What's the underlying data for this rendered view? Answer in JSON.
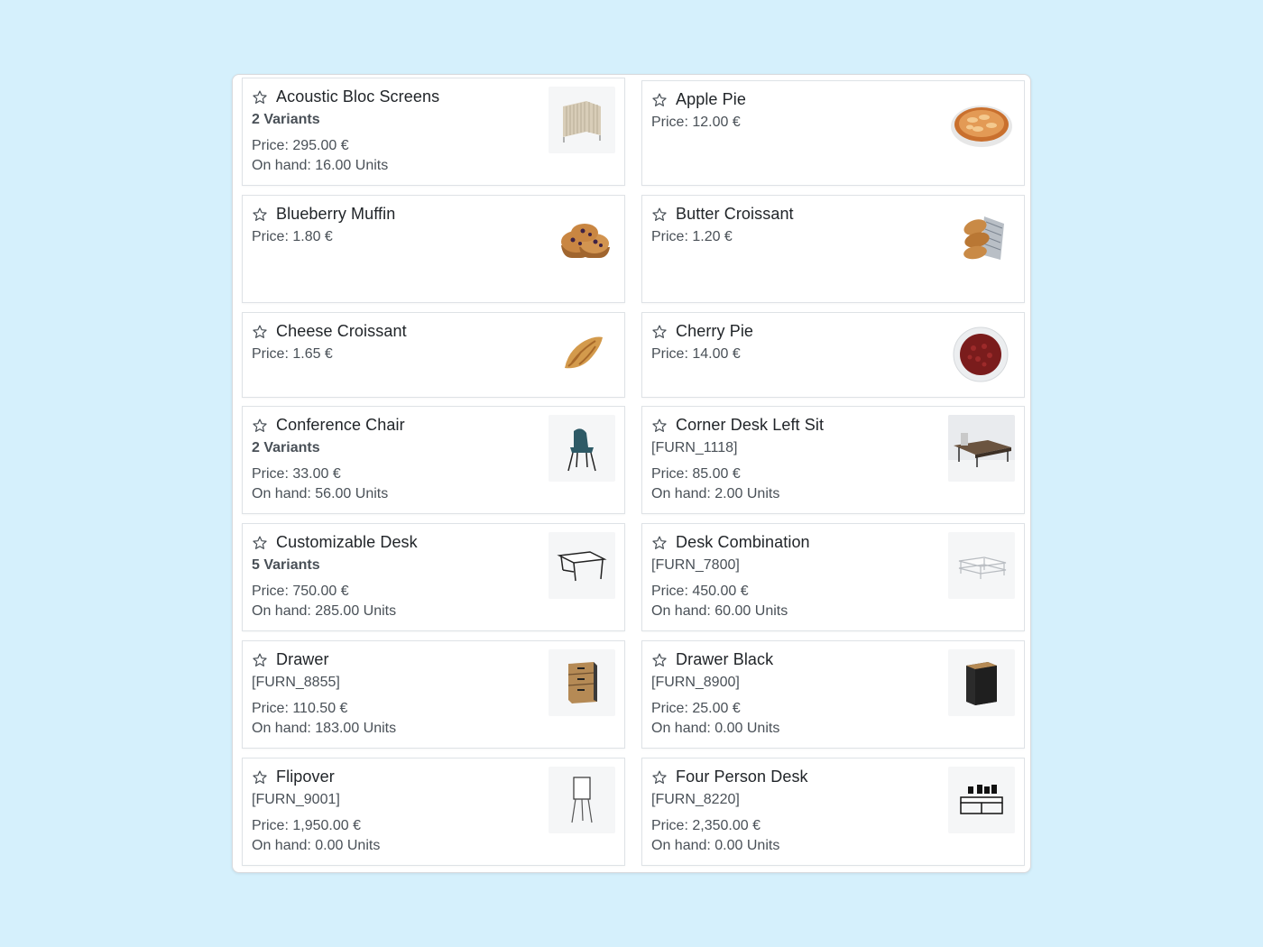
{
  "products": [
    {
      "name": "Acoustic Bloc Screens",
      "variants": "2 Variants",
      "price": "Price: 295.00 €",
      "onhand": "On hand: 16.00 Units",
      "image": "acoustic-screen-image"
    },
    {
      "name": "Apple Pie",
      "price": "Price: 12.00 €",
      "image": "apple-pie-image"
    },
    {
      "name": "Blueberry Muffin",
      "price": "Price: 1.80 €",
      "image": "blueberry-muffin-image"
    },
    {
      "name": "Butter Croissant",
      "price": "Price: 1.20 €",
      "image": "butter-croissant-image"
    },
    {
      "name": "Cheese Croissant",
      "price": "Price: 1.65 €",
      "image": "cheese-croissant-image"
    },
    {
      "name": "Cherry Pie",
      "price": "Price: 14.00 €",
      "image": "cherry-pie-image"
    },
    {
      "name": "Conference Chair",
      "variants": "2 Variants",
      "price": "Price: 33.00 €",
      "onhand": "On hand: 56.00 Units",
      "image": "conference-chair-image"
    },
    {
      "name": "Corner Desk Left Sit",
      "ref": "[FURN_1118]",
      "price": "Price: 85.00 €",
      "onhand": "On hand: 2.00 Units",
      "image": "corner-desk-image"
    },
    {
      "name": "Customizable Desk",
      "variants": "5 Variants",
      "price": "Price: 750.00 €",
      "onhand": "On hand: 285.00 Units",
      "image": "customizable-desk-image"
    },
    {
      "name": "Desk Combination",
      "ref": "[FURN_7800]",
      "price": "Price: 450.00 €",
      "onhand": "On hand: 60.00 Units",
      "image": "desk-combination-image"
    },
    {
      "name": "Drawer",
      "ref": "[FURN_8855]",
      "price": "Price: 110.50 €",
      "onhand": "On hand: 183.00 Units",
      "image": "drawer-image"
    },
    {
      "name": "Drawer Black",
      "ref": "[FURN_8900]",
      "price": "Price: 25.00 €",
      "onhand": "On hand: 0.00 Units",
      "image": "drawer-black-image"
    },
    {
      "name": "Flipover",
      "ref": "[FURN_9001]",
      "price": "Price: 1,950.00 €",
      "onhand": "On hand: 0.00 Units",
      "image": "flipover-image"
    },
    {
      "name": "Four Person Desk",
      "ref": "[FURN_8220]",
      "price": "Price: 2,350.00 €",
      "onhand": "On hand: 0.00 Units",
      "image": "four-person-desk-image"
    }
  ],
  "colors": {
    "background": "#d5f0fc",
    "card_border": "#dee2e6",
    "text": "#212529",
    "muted": "#495057"
  },
  "icons": {
    "favorite": "star-outline-icon"
  }
}
